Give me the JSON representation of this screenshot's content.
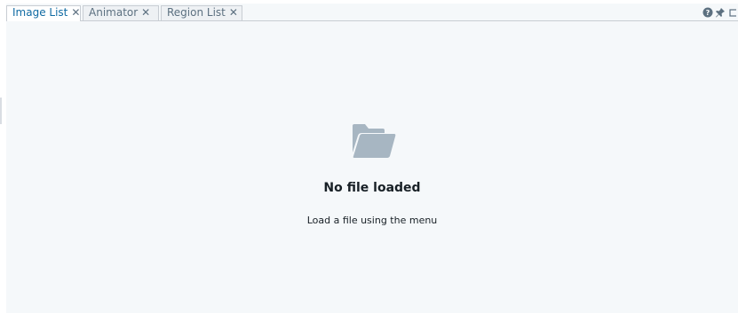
{
  "tabs": [
    {
      "label": "Image List",
      "close": "✕",
      "active": true
    },
    {
      "label": "Animator",
      "close": "✕",
      "active": false
    },
    {
      "label": "Region List",
      "close": "✕",
      "active": false
    }
  ],
  "toolbar": {
    "icons": [
      "help-icon",
      "pin-icon",
      "maximize-icon"
    ]
  },
  "empty_state": {
    "icon": "folder-open-icon",
    "title": "No file loaded",
    "description": "Load a file using the menu"
  },
  "colors": {
    "background": "#f5f8fa",
    "active_tab_text": "#106ba3",
    "inactive_tab_text": "#5c7080",
    "icon_gray": "#a7b6c2"
  }
}
